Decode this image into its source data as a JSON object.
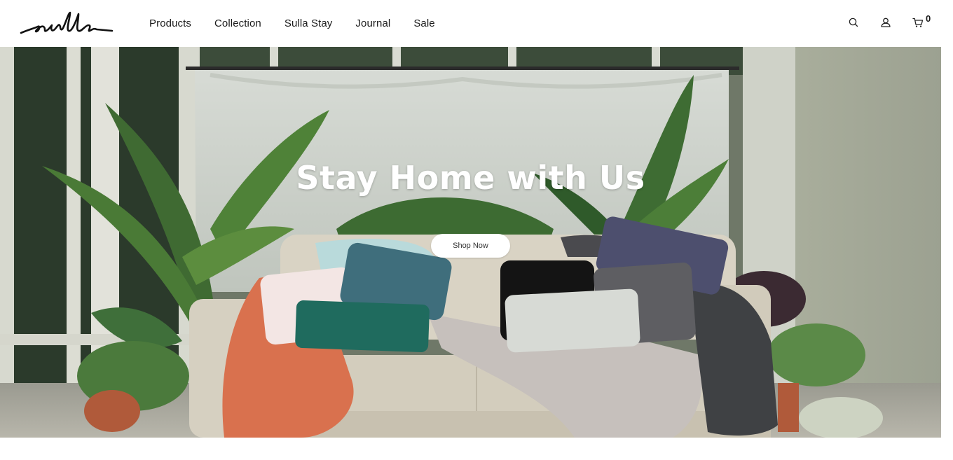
{
  "brand": {
    "logo_text": "sulla",
    "logo_icon": "sulla-wordmark-logo"
  },
  "nav": {
    "items": [
      {
        "label": "Products"
      },
      {
        "label": "Collection"
      },
      {
        "label": "Sulla Stay"
      },
      {
        "label": "Journal"
      },
      {
        "label": "Sale"
      }
    ]
  },
  "header_icons": {
    "search_icon": "search-icon",
    "account_icon": "user-icon",
    "cart_icon": "cart-icon",
    "cart_count": "0"
  },
  "hero": {
    "title": "Stay Home with Us",
    "cta_label": "Shop Now",
    "image_subject": "sofa-with-pillows-and-plants"
  },
  "colors": {
    "text": "#1b1b1b",
    "white": "#ffffff",
    "orange_throw": "#d9714e",
    "teal_pillow": "#1f6b5e",
    "sofa": "#d8d2c3"
  }
}
